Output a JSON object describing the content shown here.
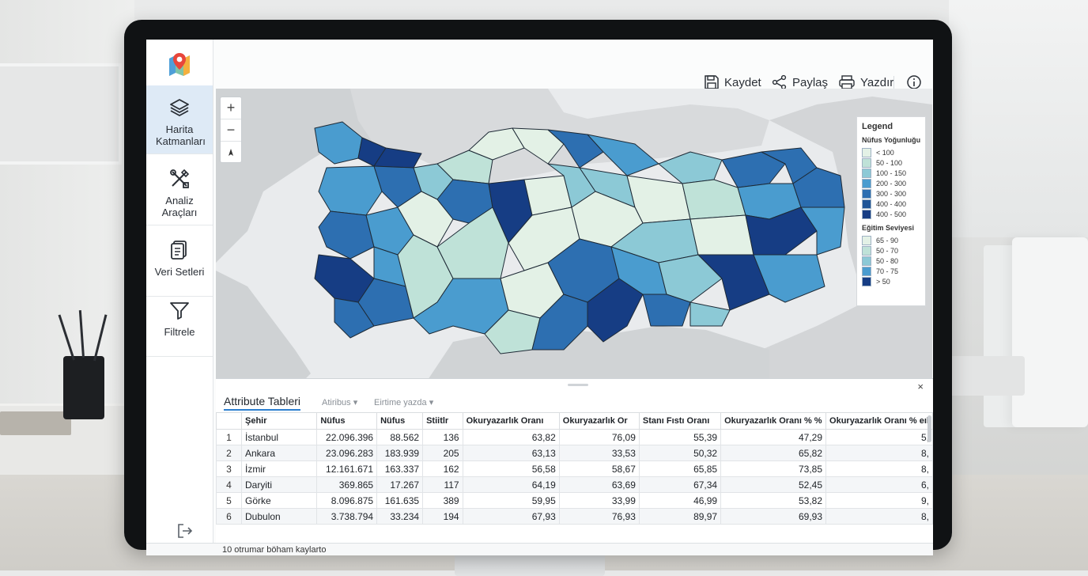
{
  "sidebar": {
    "logo_icon": "map-pin-logo",
    "items": [
      {
        "label": "Harita Katmanları",
        "icon": "layers-icon",
        "active": true
      },
      {
        "label": "Analiz Araçları",
        "icon": "tools-icon",
        "active": false
      },
      {
        "label": "Veri Setleri",
        "icon": "documents-icon",
        "active": false
      },
      {
        "label": "Filtrele",
        "icon": "filter-icon",
        "active": false
      }
    ],
    "exit_icon": "logout-icon"
  },
  "toolbar": {
    "save_label": "Kaydet",
    "share_label": "Paylaş",
    "print_label": "Yazdır",
    "info_icon": "info-icon"
  },
  "map": {
    "zoom_in": "+",
    "zoom_out": "−",
    "accent_palette": [
      "#e3f1e6",
      "#bfe2d8",
      "#8cc9d6",
      "#4a9ccf",
      "#2d6fb1",
      "#163d84"
    ],
    "legend": {
      "title": "Legend",
      "section1_title": "Nüfus Yoğunluğu",
      "section1_items": [
        "< 100",
        "50 - 100",
        "100 - 150",
        "200 - 300",
        "300 - 300",
        "400 - 400",
        "400 - 500"
      ],
      "section2_title": "Eğitim Seviyesi",
      "section2_items": [
        "65 - 90",
        "50 - 70",
        "50 - 80",
        "70 - 75",
        "> 50"
      ]
    }
  },
  "attribute_panel": {
    "close": "×",
    "tab_active": "Attribute Tableri",
    "tab2": "Atiribus ▾",
    "tab3": "Eirtime yazda ▾",
    "columns": [
      "",
      "Şehir",
      "Nüfus",
      "Nüfus",
      "Stiitlr",
      "Okuryazarlık Oranı",
      "Okuryazarlık Or",
      "Stanı Fıstı Oranı",
      "Okuryazarlık Oranı % %",
      "Okuryazarlık Oranı % eıl"
    ],
    "rows": [
      [
        "1",
        "İstanbul",
        "22.096.396",
        "88.562",
        "136",
        "63,82",
        "76,09",
        "55,39",
        "47,29",
        "5,"
      ],
      [
        "2",
        "Ankara",
        "23.096.283",
        "183.939",
        "205",
        "63,13",
        "33,53",
        "50,32",
        "65,82",
        "8,"
      ],
      [
        "3",
        "İzmir",
        "12.161.671",
        "163.337",
        "162",
        "56,58",
        "58,67",
        "65,85",
        "73,85",
        "8,"
      ],
      [
        "4",
        "Daryiti",
        "369.865",
        "17.267",
        "117",
        "64,19",
        "63,69",
        "67,34",
        "52,45",
        "6,"
      ],
      [
        "5",
        "Görke",
        "8.096.875",
        "161.635",
        "389",
        "59,95",
        "33,99",
        "46,99",
        "53,82",
        "9,"
      ],
      [
        "6",
        "Dubulon",
        "3.738.794",
        "33.234",
        "194",
        "67,93",
        "76,93",
        "89,97",
        "69,93",
        "8,"
      ]
    ],
    "status": "10 otrumar böham kaylarto"
  }
}
